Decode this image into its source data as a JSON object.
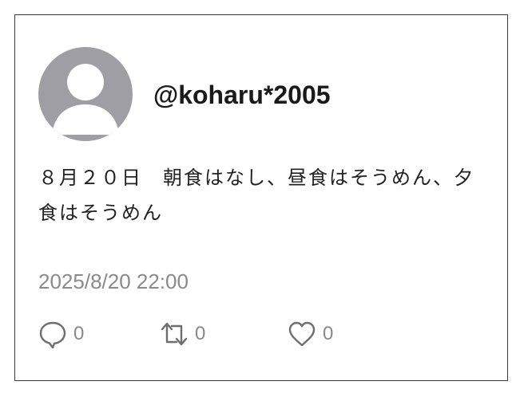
{
  "post": {
    "handle": "@koharu*2005",
    "text": "８月２０日　朝食はなし、昼食はそうめん、夕食はそうめん",
    "timestamp": "2025/8/20  22:00"
  },
  "avatar": {
    "icon": "default-user-icon",
    "bg_color": "#9e9ea4"
  },
  "actions": {
    "reply": {
      "icon": "speech-bubble-icon",
      "count": "0"
    },
    "retweet": {
      "icon": "retweet-icon",
      "count": "0"
    },
    "like": {
      "icon": "heart-icon",
      "count": "0"
    }
  },
  "colors": {
    "border": "#3a3a3a",
    "text": "#1a1a1a",
    "muted": "#8a8a8a"
  }
}
